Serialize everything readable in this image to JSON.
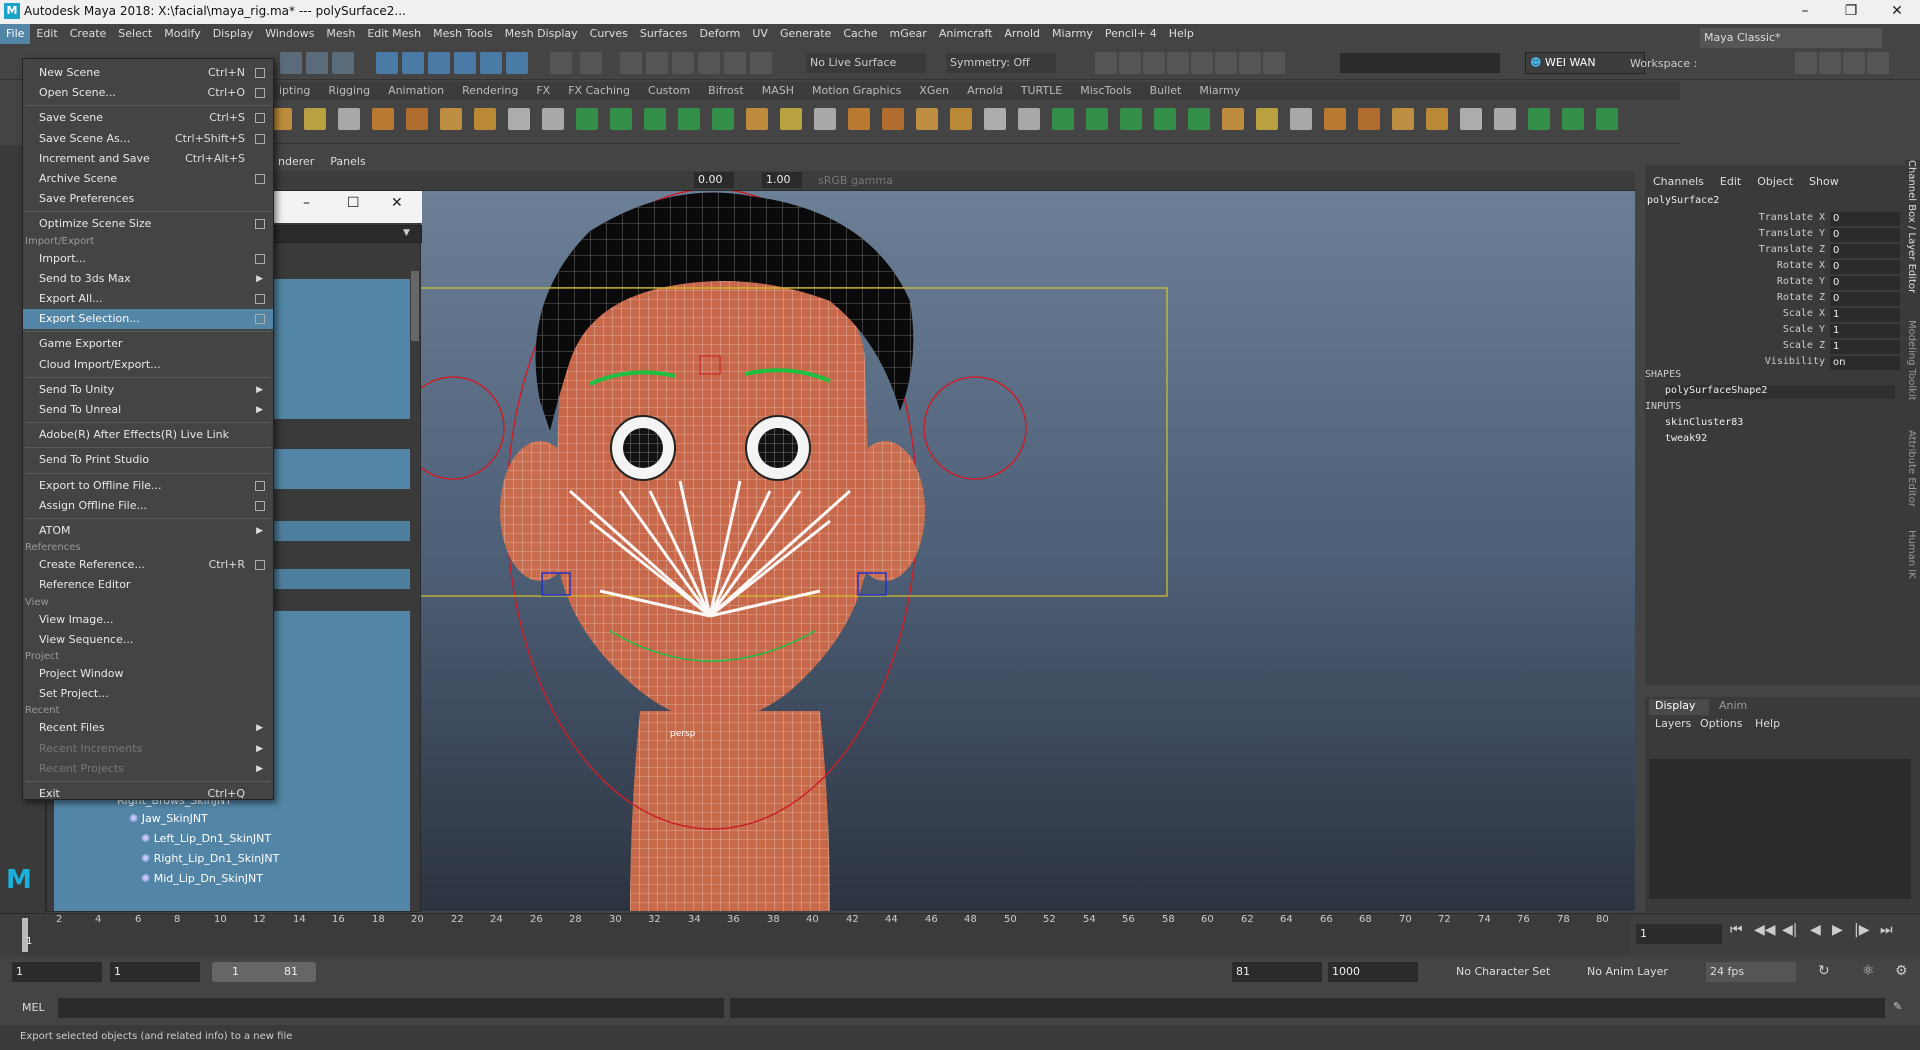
{
  "window": {
    "title": "Autodesk Maya 2018: X:\\facial\\maya_rig.ma*   ---   polySurface2...",
    "logo": "M",
    "minimize_icon": "minimize-icon",
    "maximize_icon": "maximize-icon",
    "close_icon": "close-icon"
  },
  "menubar": [
    "File",
    "Edit",
    "Create",
    "Select",
    "Modify",
    "Display",
    "Windows",
    "Mesh",
    "Edit Mesh",
    "Mesh Tools",
    "Mesh Display",
    "Curves",
    "Surfaces",
    "Deform",
    "UV",
    "Generate",
    "Cache",
    "mGear",
    "Animcraft",
    "Arnold",
    "Miarmy",
    "Pencil+ 4",
    "Help"
  ],
  "workspace": {
    "label": "Workspace :",
    "value": "Maya Classic*"
  },
  "status": {
    "live_surface": "No Live Surface",
    "symmetry": "Symmetry: Off",
    "user": "WEI WAN"
  },
  "shelf_tabs": [
    "ipting",
    "Rigging",
    "Animation",
    "Rendering",
    "FX",
    "FX Caching",
    "Custom",
    "Bifrost",
    "MASH",
    "Motion Graphics",
    "XGen",
    "Arnold",
    "TURTLE",
    "MiscTools",
    "Bullet",
    "Miarmy"
  ],
  "panel_menu": [
    "nderer",
    "Panels"
  ],
  "panel_toolbar": {
    "exposure": "0.00",
    "gamma": "1.00",
    "colorspace": "sRGB gamma"
  },
  "file_menu": {
    "items": [
      {
        "label": "New Scene",
        "shortcut": "Ctrl+N",
        "box": true
      },
      {
        "label": "Open Scene...",
        "shortcut": "Ctrl+O",
        "box": true
      },
      {
        "sep": true
      },
      {
        "label": "Save Scene",
        "shortcut": "Ctrl+S",
        "box": true
      },
      {
        "label": "Save Scene As...",
        "shortcut": "Ctrl+Shift+S",
        "box": true
      },
      {
        "label": "Increment and Save",
        "shortcut": "Ctrl+Alt+S",
        "box": false
      },
      {
        "label": "Archive Scene",
        "box": true
      },
      {
        "label": "Save Preferences"
      },
      {
        "sep": true
      },
      {
        "label": "Optimize Scene Size",
        "box": true
      },
      {
        "header": "Import/Export"
      },
      {
        "label": "Import...",
        "box": true
      },
      {
        "label": "Send to 3ds Max",
        "arrow": true
      },
      {
        "label": "Export All...",
        "box": true
      },
      {
        "label": "Export Selection...",
        "box": true,
        "selected": true
      },
      {
        "sep": true
      },
      {
        "label": "Game Exporter"
      },
      {
        "label": "Cloud Import/Export..."
      },
      {
        "sep": true
      },
      {
        "label": "Send To Unity",
        "arrow": true
      },
      {
        "label": "Send To Unreal",
        "arrow": true
      },
      {
        "sep": true
      },
      {
        "label": "Adobe(R) After Effects(R) Live Link"
      },
      {
        "sep": true
      },
      {
        "label": "Send To Print Studio"
      },
      {
        "sep": true
      },
      {
        "label": "Export to Offline File...",
        "box": true
      },
      {
        "label": "Assign Offline File...",
        "box": true
      },
      {
        "sep": true
      },
      {
        "label": "ATOM",
        "arrow": true
      },
      {
        "header": "References"
      },
      {
        "label": "Create Reference...",
        "shortcut": "Ctrl+R",
        "box": true
      },
      {
        "label": "Reference Editor"
      },
      {
        "header": "View"
      },
      {
        "label": "View Image..."
      },
      {
        "label": "View Sequence..."
      },
      {
        "header": "Project"
      },
      {
        "label": "Project Window"
      },
      {
        "label": "Set Project..."
      },
      {
        "header": "Recent"
      },
      {
        "label": "Recent Files",
        "arrow": true
      },
      {
        "label": "Recent Increments",
        "arrow": true,
        "disabled": true
      },
      {
        "label": "Recent Projects",
        "arrow": true,
        "disabled": true
      },
      {
        "sep": true
      },
      {
        "label": "Exit",
        "shortcut": "Ctrl+Q"
      }
    ]
  },
  "outliner": {
    "items": [
      "Right_Brows_SkinJNT",
      "Jaw_SkinJNT",
      "Left_Lip_Dn1_SkinJNT",
      "Right_Lip_Dn1_SkinJNT",
      "Mid_Lip_Dn_SkinJNT"
    ]
  },
  "viewport": {
    "camera_label": "persp"
  },
  "channel_box": {
    "menu": [
      "Channels",
      "Edit",
      "Object",
      "Show"
    ],
    "object": "polySurface2",
    "attributes": [
      {
        "name": "Translate X",
        "value": "0"
      },
      {
        "name": "Translate Y",
        "value": "0"
      },
      {
        "name": "Translate Z",
        "value": "0"
      },
      {
        "name": "Rotate X",
        "value": "0"
      },
      {
        "name": "Rotate Y",
        "value": "0"
      },
      {
        "name": "Rotate Z",
        "value": "0"
      },
      {
        "name": "Scale X",
        "value": "1"
      },
      {
        "name": "Scale Y",
        "value": "1"
      },
      {
        "name": "Scale Z",
        "value": "1"
      },
      {
        "name": "Visibility",
        "value": "on"
      }
    ],
    "shapes_header": "SHAPES",
    "shape": "polySurfaceShape2",
    "inputs_header": "INPUTS",
    "inputs": [
      "skinCluster83",
      "tweak92"
    ],
    "side_tabs": [
      "Channel Box / Layer Editor",
      "Modeling Toolkit",
      "Attribute Editor",
      "Human IK"
    ]
  },
  "layer_panel": {
    "tabs": [
      "Display",
      "Anim"
    ],
    "menu": [
      "Layers",
      "Options",
      "Help"
    ]
  },
  "time_slider": {
    "ticks": [
      "1",
      "2",
      "4",
      "6",
      "8",
      "10",
      "12",
      "14",
      "16",
      "18",
      "20",
      "22",
      "24",
      "26",
      "28",
      "30",
      "32",
      "34",
      "36",
      "38",
      "40",
      "42",
      "44",
      "46",
      "48",
      "50",
      "52",
      "54",
      "56",
      "58",
      "60",
      "62",
      "64",
      "66",
      "68",
      "70",
      "72",
      "74",
      "76",
      "78",
      "80"
    ],
    "current": "1",
    "current_field": "1"
  },
  "range_slider": {
    "start": "1",
    "start_inner": "1",
    "range_start": "1",
    "range_end": "81",
    "end_inner": "81",
    "end": "1000",
    "character_set": "No Character Set",
    "anim_layer": "No Anim Layer",
    "fps": "24 fps"
  },
  "command_line": {
    "label": "MEL"
  },
  "help_line": {
    "text": "Export selected objects (and related info) to a new file"
  }
}
